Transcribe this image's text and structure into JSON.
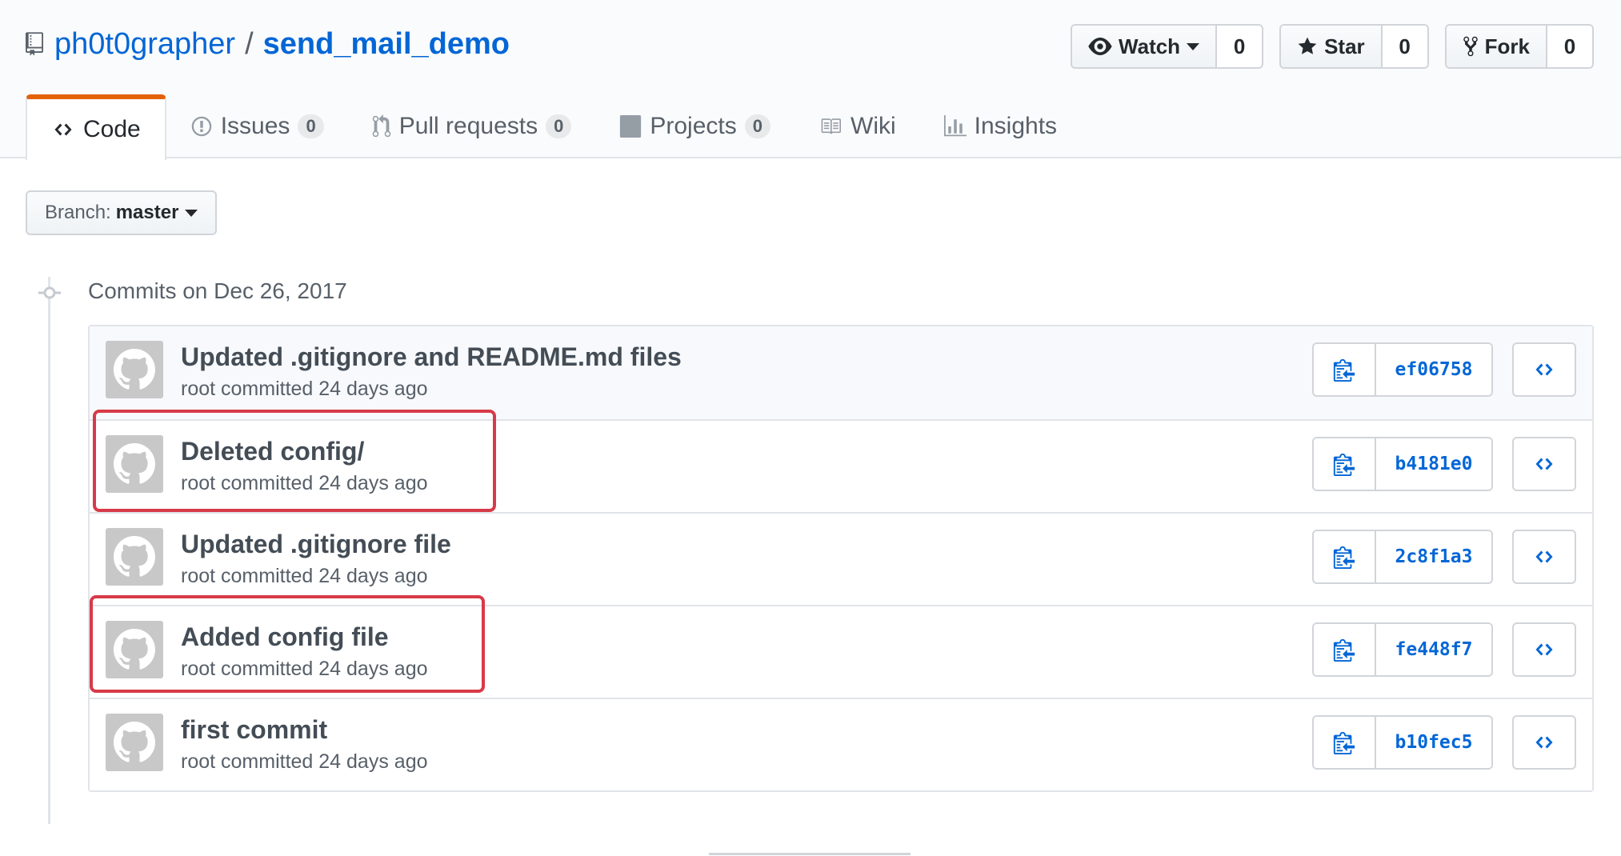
{
  "repo": {
    "owner": "ph0t0grapher",
    "separator": "/",
    "name": "send_mail_demo"
  },
  "actions": {
    "watch_label": "Watch",
    "watch_count": "0",
    "star_label": "Star",
    "star_count": "0",
    "fork_label": "Fork",
    "fork_count": "0"
  },
  "nav": {
    "code": "Code",
    "issues": "Issues",
    "issues_count": "0",
    "pulls": "Pull requests",
    "pulls_count": "0",
    "projects": "Projects",
    "projects_count": "0",
    "wiki": "Wiki",
    "insights": "Insights"
  },
  "branch": {
    "prefix": "Branch:",
    "name": "master"
  },
  "commit_group": {
    "title": "Commits on Dec 26, 2017"
  },
  "commits": [
    {
      "message": "Updated .gitignore and README.md files",
      "meta": "root committed 24 days ago",
      "sha": "ef06758"
    },
    {
      "message": "Deleted config/",
      "meta": "root committed 24 days ago",
      "sha": "b4181e0"
    },
    {
      "message": "Updated .gitignore file",
      "meta": "root committed 24 days ago",
      "sha": "2c8f1a3"
    },
    {
      "message": "Added config file",
      "meta": "root committed 24 days ago",
      "sha": "fe448f7"
    },
    {
      "message": "first commit",
      "meta": "root committed 24 days ago",
      "sha": "b10fec5"
    }
  ],
  "colors": {
    "link": "#0366d6",
    "selected_tab_accent": "#e36209",
    "annotation_highlight": "#d73a49"
  }
}
